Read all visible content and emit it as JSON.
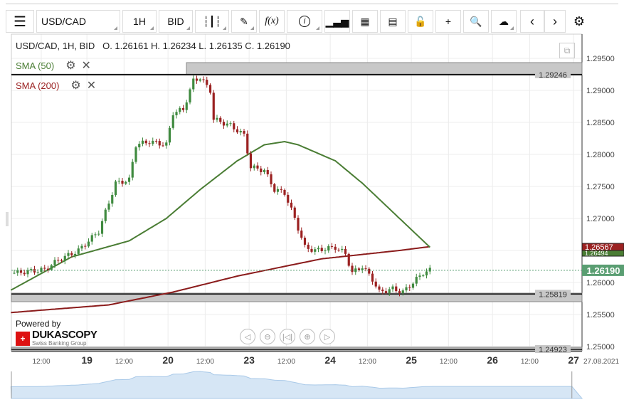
{
  "toolbar": {
    "symbol": "USD/CAD",
    "interval": "1H",
    "side": "BID",
    "icons": [
      "menu-icon",
      "candles-icon",
      "pencil-icon",
      "function-icon",
      "info-icon",
      "bars-icon",
      "calendar-icon",
      "report-icon",
      "lock-icon",
      "crosshair-icon",
      "zoom-icon",
      "cloud-upload-icon",
      "chevron-left-icon",
      "chevron-right-icon",
      "gear-icon"
    ],
    "fx": "f(x)",
    "info": "i"
  },
  "legend": {
    "title": "USD/CAD, 1H, BID",
    "ohlc": "O. 1.26161 H. 1.26234 L. 1.26135 C. 1.26190",
    "sma50": "SMA (50)",
    "sma200": "SMA (200)"
  },
  "branding": {
    "powered": "Powered by",
    "name": "DUKASCOPY",
    "tag": "Swiss Banking Group"
  },
  "colors": {
    "up": "#3f8a3f",
    "down": "#9b2121",
    "sma50": "#4a7d34",
    "sma200": "#8b1c1c",
    "last": "#5a9e72"
  },
  "chart_data": {
    "type": "candlestick",
    "price_ticks": [
      "1.29500",
      "1.29000",
      "1.28500",
      "1.28000",
      "1.27500",
      "1.27000",
      "1.26500",
      "1.26000",
      "1.25500",
      "1.25000"
    ],
    "tick_values": [
      1.295,
      1.29,
      1.285,
      1.28,
      1.275,
      1.27,
      1.265,
      1.26,
      1.255,
      1.25
    ],
    "time_labels": [
      {
        "t": 8,
        "l": "12:00"
      },
      {
        "t": 21.5,
        "l": "19"
      },
      {
        "t": 32.5,
        "l": "12:00"
      },
      {
        "t": 45.5,
        "l": "20"
      },
      {
        "t": 56.5,
        "l": "12:00"
      },
      {
        "t": 69.5,
        "l": "23"
      },
      {
        "t": 80.5,
        "l": "12:00"
      },
      {
        "t": 93.5,
        "l": "24"
      },
      {
        "t": 104.5,
        "l": "12:00"
      },
      {
        "t": 117.5,
        "l": "25"
      },
      {
        "t": 128.5,
        "l": "12:00"
      },
      {
        "t": 141.5,
        "l": "26"
      },
      {
        "t": 152.5,
        "l": "12:00"
      },
      {
        "t": 165.5,
        "l": "27"
      }
    ],
    "date_label": "27.08.2021",
    "price_path": [
      [
        0,
        1.2615
      ],
      [
        9,
        1.262
      ],
      [
        13,
        1.2635
      ],
      [
        19,
        1.265
      ],
      [
        25,
        1.268
      ],
      [
        30,
        1.2755
      ],
      [
        34,
        1.276
      ],
      [
        36,
        1.2815
      ],
      [
        40,
        1.282
      ],
      [
        45,
        1.2815
      ],
      [
        47,
        1.2865
      ],
      [
        50,
        1.287
      ],
      [
        53,
        1.2915
      ],
      [
        55,
        1.292
      ],
      [
        58,
        1.29
      ],
      [
        59,
        1.2855
      ],
      [
        64,
        1.2845
      ],
      [
        68,
        1.283
      ],
      [
        70,
        1.278
      ],
      [
        74,
        1.2775
      ],
      [
        77,
        1.2745
      ],
      [
        80,
        1.274
      ],
      [
        83,
        1.27
      ],
      [
        86,
        1.2655
      ],
      [
        89,
        1.265
      ],
      [
        95,
        1.2655
      ],
      [
        98,
        1.2645
      ],
      [
        100,
        1.2615
      ],
      [
        103,
        1.2625
      ],
      [
        106,
        1.2605
      ],
      [
        108,
        1.2585
      ],
      [
        112,
        1.259
      ],
      [
        115,
        1.2585
      ],
      [
        118,
        1.26
      ],
      [
        121,
        1.2615
      ],
      [
        123,
        1.2619
      ]
    ],
    "sma50": [
      [
        -1,
        1.2588
      ],
      [
        17,
        1.264
      ],
      [
        34,
        1.2665
      ],
      [
        45,
        1.27
      ],
      [
        55,
        1.2745
      ],
      [
        66,
        1.279
      ],
      [
        74,
        1.2815
      ],
      [
        80,
        1.282
      ],
      [
        84,
        1.2815
      ],
      [
        95,
        1.279
      ],
      [
        103,
        1.2755
      ],
      [
        113,
        1.2705
      ],
      [
        123,
        1.2655
      ]
    ],
    "sma200": [
      [
        -1,
        1.2553
      ],
      [
        28,
        1.2565
      ],
      [
        47,
        1.2585
      ],
      [
        66,
        1.261
      ],
      [
        91,
        1.2637
      ],
      [
        114,
        1.265
      ],
      [
        123,
        1.2656
      ]
    ],
    "levels": [
      {
        "v": 1.29246,
        "l": "1.29246"
      },
      {
        "v": 1.25819,
        "l": "1.25819"
      },
      {
        "v": 1.24923,
        "l": "1.24923"
      }
    ],
    "last": {
      "v": 1.2619,
      "l": "1.26190"
    },
    "sma_tags": {
      "sma200": "1.26567",
      "sma50": "1.26494"
    }
  }
}
